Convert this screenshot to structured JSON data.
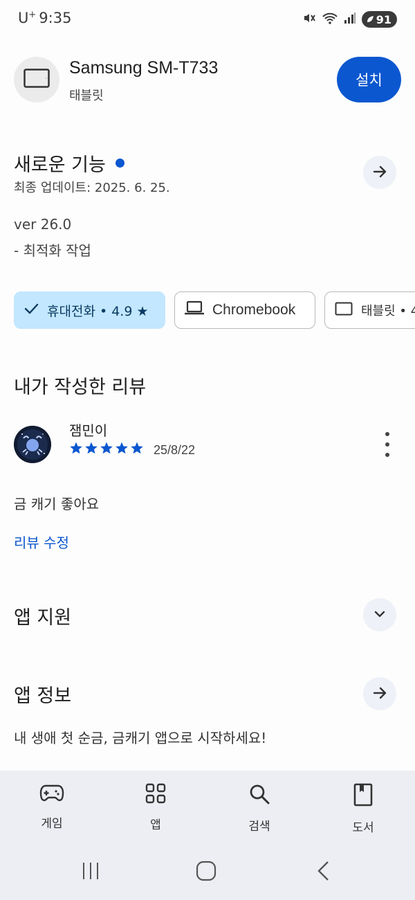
{
  "status_bar": {
    "carrier": "U",
    "carrier_sup": "+",
    "time": "9:35",
    "battery": "91"
  },
  "device": {
    "name": "Samsung SM-T733",
    "type": "태블릿",
    "install_label": "설치",
    "icon": "tablet-icon"
  },
  "whats_new": {
    "title": "새로운 기능",
    "last_updated": "최종 업데이트: 2025. 6. 25.",
    "version": "ver 26.0",
    "note": "- 최적화 작업"
  },
  "device_chips": [
    {
      "label": "휴대전화 • 4.9 ★",
      "selected": true,
      "icon": "check-icon"
    },
    {
      "label": "Chromebook",
      "selected": false,
      "icon": "laptop-icon"
    },
    {
      "label": "태블릿 • 4",
      "selected": false,
      "icon": "tablet-icon"
    }
  ],
  "my_review": {
    "section_title": "내가 작성한 리뷰",
    "reviewer": "잼민이",
    "rating": 5,
    "max_rating": 5,
    "date": "25/8/22",
    "text": "금 캐기 좋아요",
    "edit_label": "리뷰 수정"
  },
  "app_support": {
    "title": "앱 지원"
  },
  "app_info": {
    "title": "앱 정보",
    "description": "내 생애 첫 순금, 금캐기 앱으로 시작하세요!"
  },
  "bottom_nav": [
    {
      "label": "게임",
      "icon": "gamepad-icon"
    },
    {
      "label": "앱",
      "icon": "apps-grid-icon"
    },
    {
      "label": "검색",
      "icon": "search-icon"
    },
    {
      "label": "도서",
      "icon": "book-icon"
    }
  ],
  "colors": {
    "accent": "#0b57d0",
    "chip_selected": "#c2e7ff",
    "nav_bg": "#eceef3"
  }
}
